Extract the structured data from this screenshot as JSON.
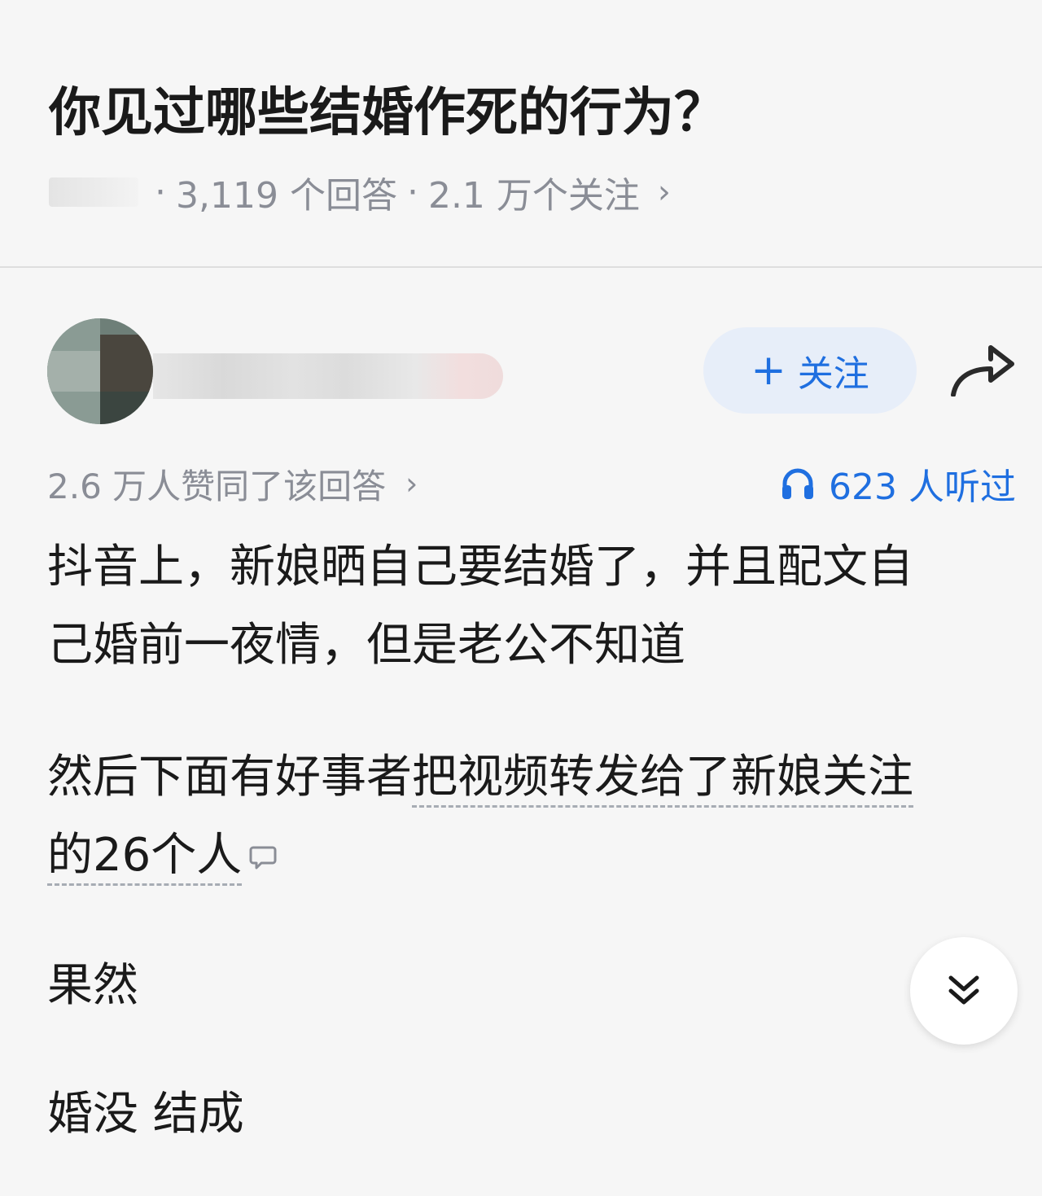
{
  "question": {
    "title": "你见过哪些结婚作死的行为？",
    "meta_dot": "·",
    "answers_count": "3,119 个回答",
    "follow_count": "2.1 万个关注",
    "chevron": "›"
  },
  "author": {
    "follow_plus": "+",
    "follow_label": "关注"
  },
  "stats": {
    "upvote_text": "2.6 万人赞同了该回答",
    "chevron": "›",
    "listen_text": "623 人听过"
  },
  "answer": {
    "line1": "抖音上，新娘晒自己要结婚了，并且配文自",
    "line2": "己婚前一夜情，但是老公不知道",
    "line3_plain": "然后下面有好事者",
    "line3_underlined": "把视频转发给了新娘关注",
    "line4_underlined": "的26个人",
    "line5": "果然",
    "line6": "婚没 结成"
  },
  "icons": {
    "share": "share-arrow-icon",
    "headphones": "headphones-icon",
    "comment": "comment-bubble-icon",
    "expand": "double-chevron-down-icon"
  },
  "colors": {
    "accent_blue": "#1f6fe0",
    "follow_bg": "#e7eef9",
    "meta_gray": "#8a8d96",
    "background": "#f6f6f6"
  }
}
